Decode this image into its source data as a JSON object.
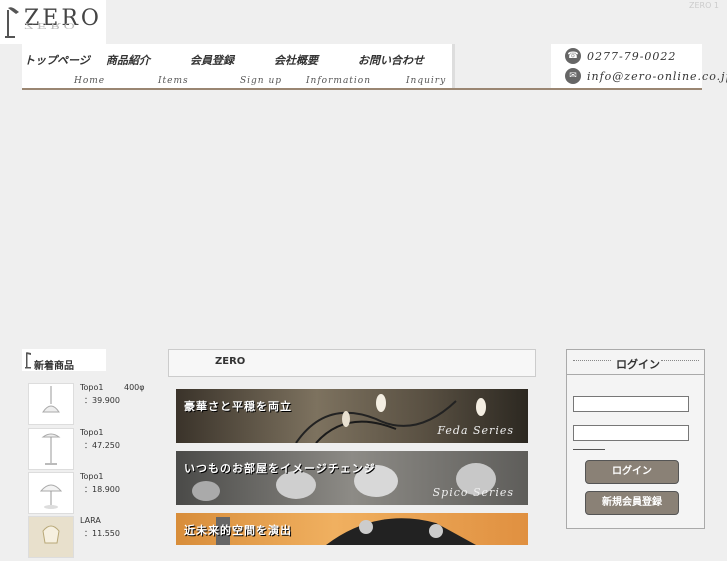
{
  "logo": {
    "text": "ZERO"
  },
  "corner_text": "ZERO 1",
  "nav": [
    {
      "jp": "トップページ",
      "en": "Home"
    },
    {
      "jp": "商品紹介",
      "en": "Items"
    },
    {
      "jp": "会員登録",
      "en": "Sign up"
    },
    {
      "jp": "会社概要",
      "en": "Information"
    },
    {
      "jp": "お問い合わせ",
      "en": "Inquiry"
    }
  ],
  "contact": {
    "phone": "0277-79-0022",
    "email": "info@zero-online.co.jp"
  },
  "new_items": {
    "title": "新着商品",
    "items": [
      {
        "name": "Topo1",
        "size": "400φ",
        "price": "：39.900"
      },
      {
        "name": "Topo1",
        "size": "",
        "price": "：47.250"
      },
      {
        "name": "Topo1",
        "size": "",
        "price": "：18.900"
      },
      {
        "name": "LARA",
        "size": "",
        "price": "：11.550"
      }
    ]
  },
  "main": {
    "title": "ZERO"
  },
  "banners": [
    {
      "text": "豪華さと平穏を両立",
      "series": "Feda Series"
    },
    {
      "text": "いつものお部屋をイメージチェンジ",
      "series": "Spico Series"
    },
    {
      "text": "近未来的空間を演出",
      "series": ""
    }
  ],
  "login": {
    "title": "ログイン",
    "login_button": "ログイン",
    "register_button": "新規会員登録"
  },
  "colors": {
    "background": "#efefef",
    "nav_line": "#9a8672",
    "button": "#8a8176"
  }
}
